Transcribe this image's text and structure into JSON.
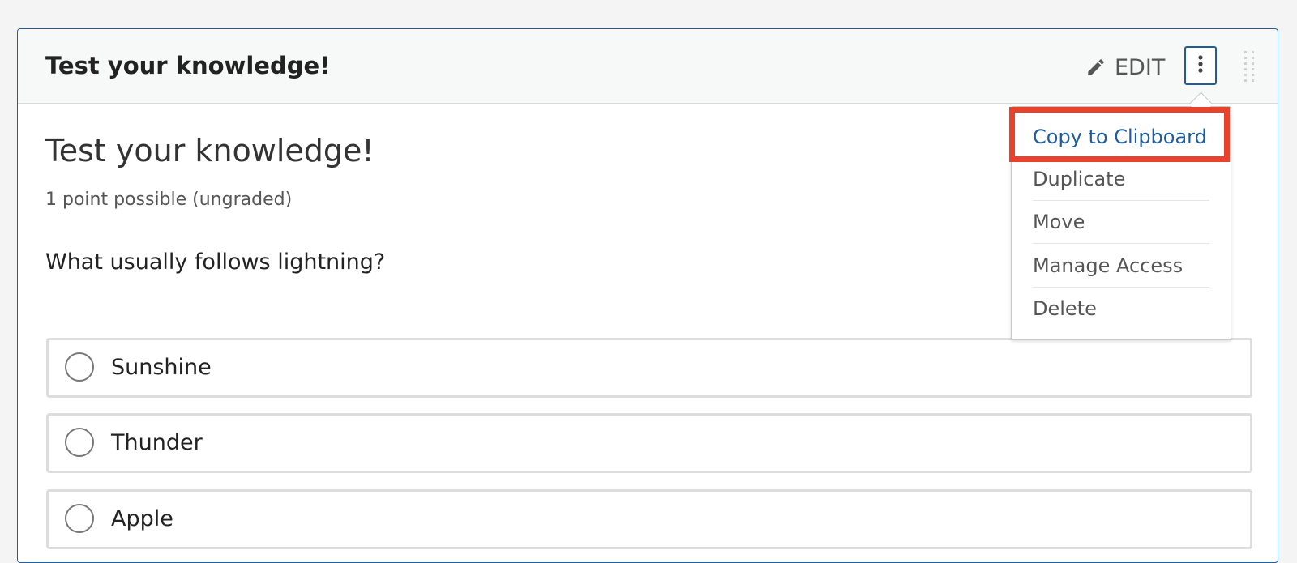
{
  "header": {
    "title": "Test your knowledge!",
    "edit_label": "EDIT",
    "edit_icon": "pencil-icon",
    "actions_icon": "vertical-ellipsis-icon",
    "drag_icon": "drag-handle-icon"
  },
  "problem": {
    "title": "Test your knowledge!",
    "points": "1 point possible (ungraded)",
    "question": "What usually follows lightning?",
    "choices": [
      {
        "label": "Sunshine",
        "selected": false
      },
      {
        "label": "Thunder",
        "selected": false
      },
      {
        "label": "Apple",
        "selected": false
      }
    ]
  },
  "menu": {
    "items": [
      {
        "label": "Copy to Clipboard",
        "highlighted": true
      },
      {
        "label": "Duplicate"
      },
      {
        "label": "Move"
      },
      {
        "label": "Manage Access"
      },
      {
        "label": "Delete"
      }
    ]
  },
  "colors": {
    "accent": "#1f5c9c",
    "highlight_box": "#e8412c"
  }
}
